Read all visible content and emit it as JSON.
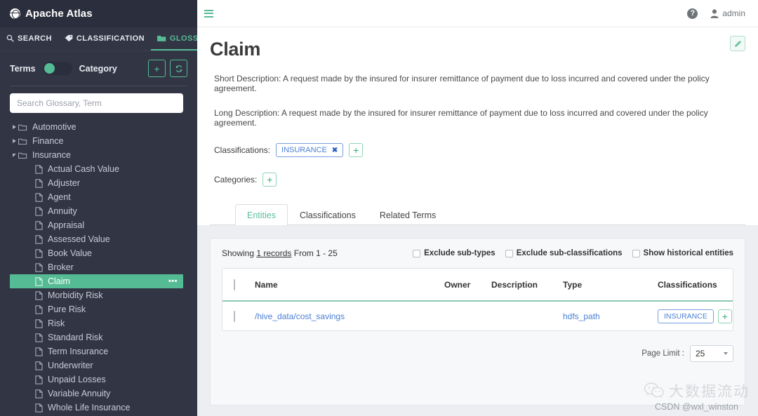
{
  "sidebar": {
    "brand": "Apache Atlas",
    "brand_icon": "globe-icon",
    "nav_tabs": [
      {
        "label": "SEARCH",
        "icon": "search-icon",
        "active": false
      },
      {
        "label": "CLASSIFICATION",
        "icon": "tag-icon",
        "active": false
      },
      {
        "label": "GLOSSARY",
        "icon": "folder-icon",
        "active": true
      }
    ],
    "toggle": {
      "left_label": "Terms",
      "right_label": "Category",
      "state": "Terms"
    },
    "add_button_icon": "plus-icon",
    "refresh_button_icon": "refresh-icon",
    "search": {
      "placeholder": "Search Glossary, Term",
      "value": ""
    },
    "tree": [
      {
        "label": "Automotive",
        "level": 0,
        "expanded": false,
        "icon": "folder-icon"
      },
      {
        "label": "Finance",
        "level": 0,
        "expanded": false,
        "icon": "folder-icon"
      },
      {
        "label": "Insurance",
        "level": 0,
        "expanded": true,
        "icon": "folder-icon"
      },
      {
        "label": "Actual Cash Value",
        "level": 1,
        "icon": "file-icon"
      },
      {
        "label": "Adjuster",
        "level": 1,
        "icon": "file-icon"
      },
      {
        "label": "Agent",
        "level": 1,
        "icon": "file-icon"
      },
      {
        "label": "Annuity",
        "level": 1,
        "icon": "file-icon"
      },
      {
        "label": "Appraisal",
        "level": 1,
        "icon": "file-icon"
      },
      {
        "label": "Assessed Value",
        "level": 1,
        "icon": "file-icon"
      },
      {
        "label": "Book Value",
        "level": 1,
        "icon": "file-icon"
      },
      {
        "label": "Broker",
        "level": 1,
        "icon": "file-icon"
      },
      {
        "label": "Claim",
        "level": 1,
        "icon": "file-icon",
        "selected": true,
        "menu_icon": "ellipsis-icon"
      },
      {
        "label": "Morbidity Risk",
        "level": 1,
        "icon": "file-icon"
      },
      {
        "label": "Pure Risk",
        "level": 1,
        "icon": "file-icon"
      },
      {
        "label": "Risk",
        "level": 1,
        "icon": "file-icon"
      },
      {
        "label": "Standard Risk",
        "level": 1,
        "icon": "file-icon"
      },
      {
        "label": "Term Insurance",
        "level": 1,
        "icon": "file-icon"
      },
      {
        "label": "Underwriter",
        "level": 1,
        "icon": "file-icon"
      },
      {
        "label": "Unpaid Losses",
        "level": 1,
        "icon": "file-icon"
      },
      {
        "label": "Variable Annuity",
        "level": 1,
        "icon": "file-icon"
      },
      {
        "label": "Whole Life Insurance",
        "level": 1,
        "icon": "file-icon"
      }
    ]
  },
  "topbar": {
    "menu_icon": "hamburger-icon",
    "help_icon": "help-icon",
    "help_glyph": "?",
    "user_icon": "user-icon",
    "user_name": "admin"
  },
  "page": {
    "title": "Claim",
    "edit_icon": "pencil-icon",
    "short_description": "Short Description: A request made by the insured for insurer remittance of payment due to loss incurred and covered under the policy agreement.",
    "long_description": "Long Description: A request made by the insured for insurer remittance of payment due to loss incurred and covered under the policy agreement.",
    "classifications_label": "Classifications:",
    "classification_chip": "INSURANCE",
    "chip_remove_glyph": "✖",
    "add_classification_glyph": "+",
    "categories_label": "Categories:",
    "add_category_glyph": "+"
  },
  "tabs": [
    {
      "label": "Entities",
      "active": true
    },
    {
      "label": "Classifications",
      "active": false
    },
    {
      "label": "Related Terms",
      "active": false
    }
  ],
  "entities": {
    "showing_prefix": "Showing",
    "showing_count": "1 records",
    "showing_suffix": "From 1 - 25",
    "filters": [
      {
        "label": "Exclude sub-types",
        "checked": false
      },
      {
        "label": "Exclude sub-classifications",
        "checked": false
      },
      {
        "label": "Show historical entities",
        "checked": false
      }
    ],
    "columns": [
      "Name",
      "Owner",
      "Description",
      "Type",
      "Classifications"
    ],
    "rows": [
      {
        "checked": false,
        "name": "/hive_data/cost_savings",
        "owner": "",
        "description": "",
        "type": "hdfs_path",
        "classification": "INSURANCE",
        "add_glyph": "+"
      }
    ],
    "page_limit_label": "Page Limit :",
    "page_limit_value": "25"
  },
  "watermark": {
    "icon": "wechat-icon",
    "cn_text": "大数据流动",
    "credit": "CSDN @wxl_winston"
  },
  "colors": {
    "accent_green": "#55bb95",
    "sidebar_bg": "#323544",
    "sidebar_header_bg": "#2b2e3c",
    "link_blue": "#4a7fd4",
    "panel_bg": "#eceef1"
  }
}
